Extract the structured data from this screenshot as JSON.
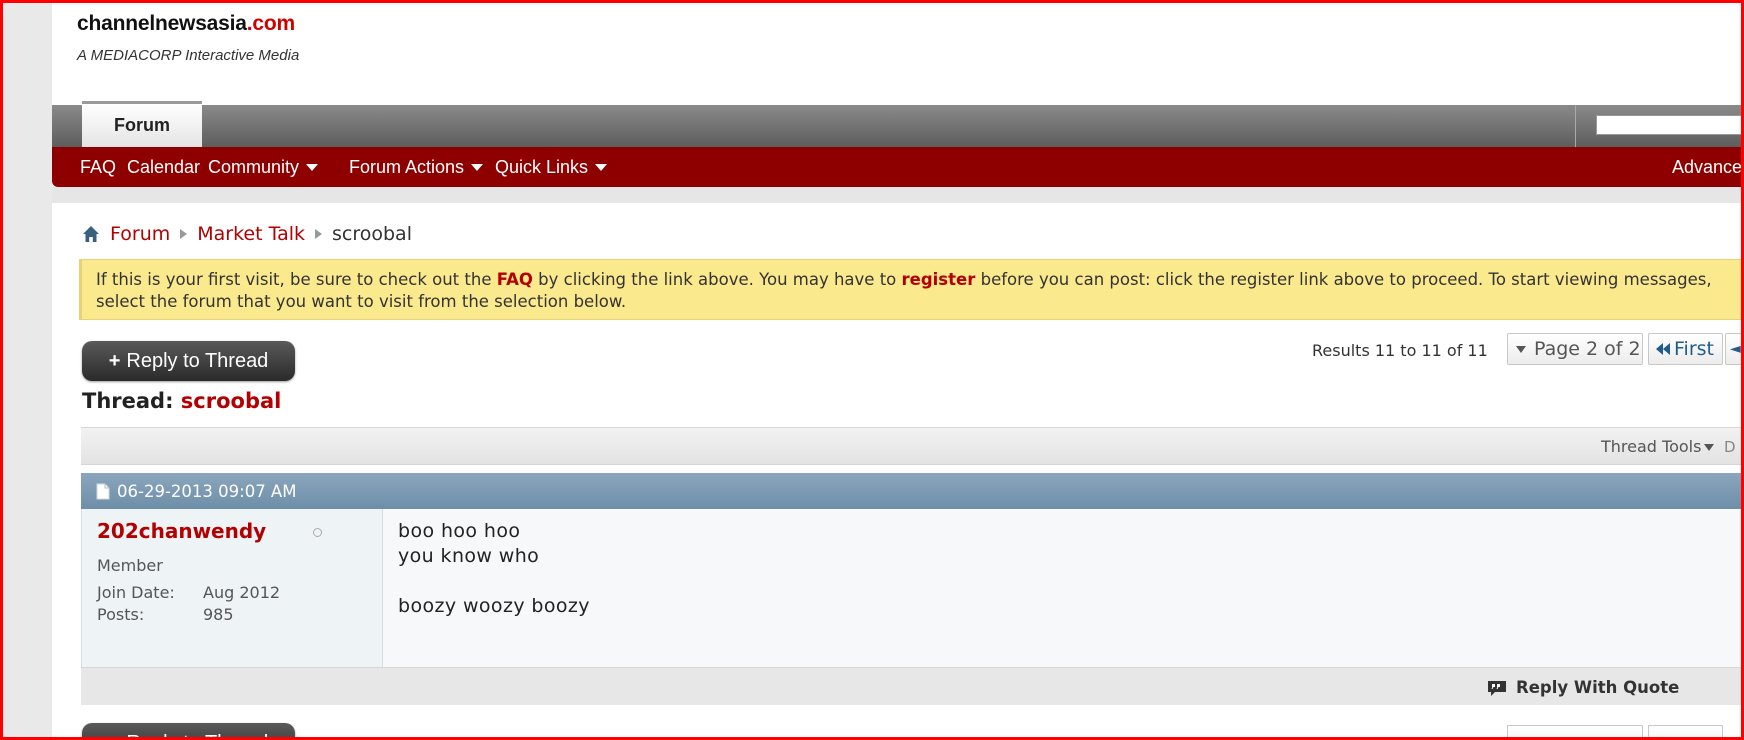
{
  "header": {
    "logo_main": "channelnewsasia",
    "logo_suffix": ".com",
    "logo_sub": "A MEDIACORP Interactive Media"
  },
  "tabs": [
    {
      "label": "Forum",
      "active": true
    }
  ],
  "search": {
    "placeholder": ""
  },
  "subnav": {
    "faq": "FAQ",
    "calendar": "Calendar",
    "community": "Community",
    "forum_actions": "Forum Actions",
    "quick_links": "Quick Links",
    "advanced": "Advanced Search"
  },
  "breadcrumb": {
    "forum": "Forum",
    "market_talk": "Market Talk",
    "current": "scroobal"
  },
  "notice": {
    "part1": "If this is your first visit, be sure to check out the ",
    "faq": "FAQ",
    "part2": " by clicking the link above. You may have to ",
    "register": "register",
    "part3": " before you can post: click the register link above to proceed. To start viewing messages, select the forum that you want to visit from the selection below."
  },
  "thread": {
    "reply_button": "Reply to Thread",
    "title_label": "Thread:",
    "title_name": "scroobal"
  },
  "pagination": {
    "results": "Results 11 to 11 of 11",
    "page": "Page 2 of 2",
    "first": "First",
    "prev": "◄"
  },
  "toolbar": {
    "thread_tools": "Thread Tools",
    "separator": "D"
  },
  "post": {
    "date": "06-29-2013 09:07 AM",
    "username": "202chanwendy",
    "user_title": "Member",
    "join_label": "Join Date:",
    "join_value": "Aug 2012",
    "posts_label": "Posts:",
    "posts_value": "985",
    "body_line1": "boo hoo hoo",
    "body_line2": "you know who",
    "body_line3": "boozy woozy boozy",
    "reply_with_quote": "Reply With Quote"
  },
  "colors": {
    "brand_red": "#8e0000",
    "link_red": "#b30000",
    "notice_bg": "#fbe98e",
    "post_header": "#7b99b2"
  }
}
